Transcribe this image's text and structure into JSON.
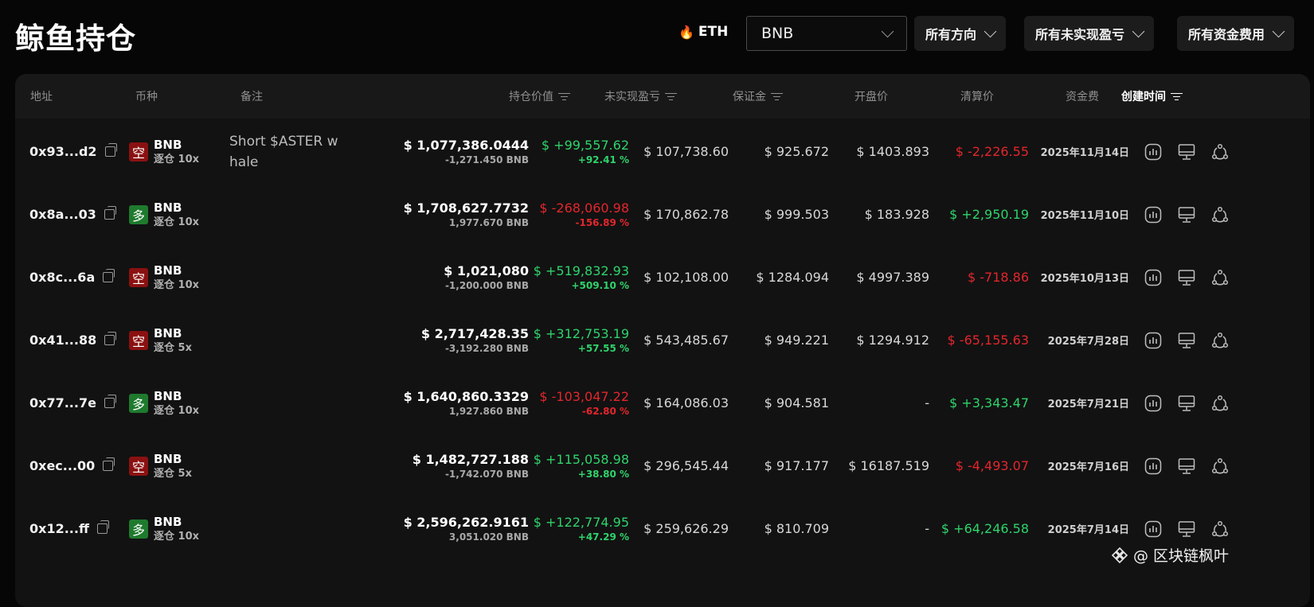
{
  "header": {
    "title": "鲸鱼持仓",
    "eth_label": "ETH",
    "coin_select": "BNB",
    "filters": [
      "所有方向",
      "所有未实现盈亏",
      "所有资金费用"
    ]
  },
  "table": {
    "columns": {
      "address": "地址",
      "coin": "币种",
      "note": "备注",
      "position_value": "持仓价值",
      "unrealized_pnl": "未实现盈亏",
      "margin": "保证金",
      "open_price": "开盘价",
      "liq_price": "清算价",
      "funding": "资金费",
      "created": "创建时间"
    },
    "rows": [
      {
        "address": "0x93...d2",
        "side": "空",
        "side_type": "short",
        "coin": "BNB",
        "leverage": "逐仓 10x",
        "note": "Short $ASTER w\nhale",
        "value": "$ 1,077,386.0444",
        "qty": "-1,271.450 BNB",
        "pnl": "$ +99,557.62",
        "pnl_pct": "+92.41 %",
        "pnl_sign": "pos",
        "margin": "$ 107,738.60",
        "open": "$ 925.672",
        "liq": "$ 1403.893",
        "funding": "$ -2,226.55",
        "funding_sign": "neg",
        "date": "2025年11月14日"
      },
      {
        "address": "0x8a...03",
        "side": "多",
        "side_type": "long",
        "coin": "BNB",
        "leverage": "逐仓 10x",
        "note": "",
        "value": "$ 1,708,627.7732",
        "qty": "1,977.670 BNB",
        "pnl": "$ -268,060.98",
        "pnl_pct": "-156.89 %",
        "pnl_sign": "neg",
        "margin": "$ 170,862.78",
        "open": "$ 999.503",
        "liq": "$ 183.928",
        "funding": "$ +2,950.19",
        "funding_sign": "pos",
        "date": "2025年11月10日"
      },
      {
        "address": "0x8c...6a",
        "side": "空",
        "side_type": "short",
        "coin": "BNB",
        "leverage": "逐仓 10x",
        "note": "",
        "value": "$ 1,021,080",
        "qty": "-1,200.000 BNB",
        "pnl": "$ +519,832.93",
        "pnl_pct": "+509.10 %",
        "pnl_sign": "pos",
        "margin": "$ 102,108.00",
        "open": "$ 1284.094",
        "liq": "$ 4997.389",
        "funding": "$ -718.86",
        "funding_sign": "neg",
        "date": "2025年10月13日"
      },
      {
        "address": "0x41...88",
        "side": "空",
        "side_type": "short",
        "coin": "BNB",
        "leverage": "逐仓 5x",
        "note": "",
        "value": "$ 2,717,428.35",
        "qty": "-3,192.280 BNB",
        "pnl": "$ +312,753.19",
        "pnl_pct": "+57.55 %",
        "pnl_sign": "pos",
        "margin": "$ 543,485.67",
        "open": "$ 949.221",
        "liq": "$ 1294.912",
        "funding": "$ -65,155.63",
        "funding_sign": "neg",
        "date": "2025年7月28日"
      },
      {
        "address": "0x77...7e",
        "side": "多",
        "side_type": "long",
        "coin": "BNB",
        "leverage": "逐仓 10x",
        "note": "",
        "value": "$ 1,640,860.3329",
        "qty": "1,927.860 BNB",
        "pnl": "$ -103,047.22",
        "pnl_pct": "-62.80 %",
        "pnl_sign": "neg",
        "margin": "$ 164,086.03",
        "open": "$ 904.581",
        "liq": "-",
        "funding": "$ +3,343.47",
        "funding_sign": "pos",
        "date": "2025年7月21日"
      },
      {
        "address": "0xec...00",
        "side": "空",
        "side_type": "short",
        "coin": "BNB",
        "leverage": "逐仓 5x",
        "note": "",
        "value": "$ 1,482,727.188",
        "qty": "-1,742.070 BNB",
        "pnl": "$ +115,058.98",
        "pnl_pct": "+38.80 %",
        "pnl_sign": "pos",
        "margin": "$ 296,545.44",
        "open": "$ 917.177",
        "liq": "$ 16187.519",
        "funding": "$ -4,493.07",
        "funding_sign": "neg",
        "date": "2025年7月16日"
      },
      {
        "address": "0x12...ff",
        "side": "多",
        "side_type": "long",
        "coin": "BNB",
        "leverage": "逐仓 10x",
        "note": "",
        "value": "$ 2,596,262.9161",
        "qty": "3,051.020 BNB",
        "pnl": "$ +122,774.95",
        "pnl_pct": "+47.29 %",
        "pnl_sign": "pos",
        "margin": "$ 259,626.29",
        "open": "$ 810.709",
        "liq": "-",
        "funding": "$ +64,246.58",
        "funding_sign": "pos",
        "date": "2025年7月14日"
      }
    ]
  },
  "watermark": "@ 区块链枫叶",
  "colors": {
    "positive": "#2fd36b",
    "negative": "#e3262c",
    "short_badge": "#8b1111",
    "long_badge": "#1f7a2e"
  }
}
